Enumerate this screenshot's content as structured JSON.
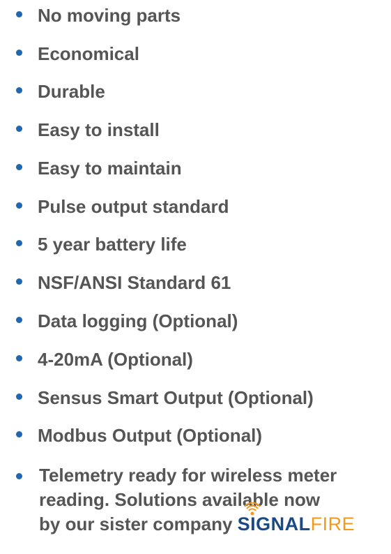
{
  "features": [
    {
      "text": "No moving parts"
    },
    {
      "text": "Economical"
    },
    {
      "text": "Durable"
    },
    {
      "text": "Easy to install"
    },
    {
      "text": "Easy to maintain"
    },
    {
      "text": "Pulse output standard"
    },
    {
      "text": "5 year battery life"
    },
    {
      "text": "NSF/ANSI Standard 61"
    },
    {
      "text": "Data logging (Optional)"
    },
    {
      "text": "4-20mA (Optional)"
    },
    {
      "text": "Sensus Smart Output (Optional)"
    },
    {
      "text": "Modbus Output (Optional)"
    }
  ],
  "telemetry": {
    "line1": "Telemetry ready for wireless meter",
    "line2": "reading. Solutions available now",
    "line3": "by our sister company",
    "brand_part1": "SIGNAL",
    "brand_part2": "FIRE"
  },
  "colors": {
    "bullet": "#1f67b1",
    "text": "#555555",
    "brand_blue": "#1a4a86",
    "brand_orange": "#f39a1d"
  }
}
